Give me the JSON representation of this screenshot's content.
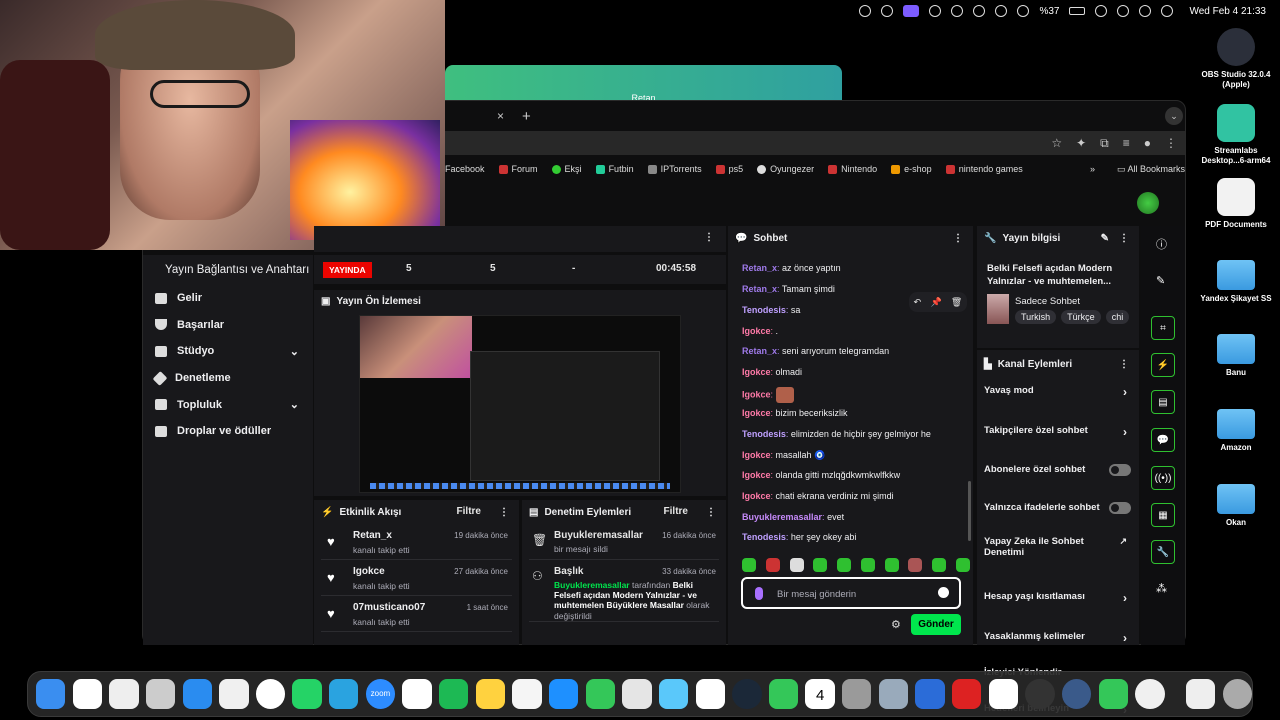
{
  "menubar": {
    "battery": "%37",
    "clock": "Wed Feb 4  21:33"
  },
  "background_window": {
    "title": "Retan"
  },
  "browser": {
    "tab_close": "×",
    "tab_new": "+",
    "bookmarks": [
      "Facebook",
      "Forum",
      "Ekşi",
      "Futbin",
      "IPTorrents",
      "ps5",
      "Oyungezer",
      "Nintendo",
      "e-shop",
      "nintendo games"
    ],
    "bookmarks_overflow": "»",
    "all_bookmarks": "All Bookmarks"
  },
  "nav": {
    "first": "Yayın Bağlantısı ve Anahtarı",
    "items": [
      {
        "label": "Gelir",
        "expand": false
      },
      {
        "label": "Başarılar",
        "expand": false
      },
      {
        "label": "Stüdyo",
        "expand": true
      },
      {
        "label": "Denetleme",
        "expand": false
      },
      {
        "label": "Topluluk",
        "expand": true
      },
      {
        "label": "Droplar ve ödüller",
        "expand": false
      }
    ]
  },
  "status": {
    "live": "YAYINDA",
    "stat1": "5",
    "stat2": "5",
    "stat3": "-",
    "uptime": "00:45:58"
  },
  "preview": {
    "title": "Yayın Ön İzlemesi"
  },
  "activity": {
    "title": "Etkinlik Akışı",
    "filter": "Filtre",
    "rows": [
      {
        "name": "Retan_x",
        "sub": "kanalı takip etti",
        "time": "19 dakika önce"
      },
      {
        "name": "Igokce",
        "sub": "kanalı takip etti",
        "time": "27 dakika önce"
      },
      {
        "name": "07musticano07",
        "sub": "kanalı takip etti",
        "time": "1 saat önce"
      }
    ]
  },
  "modactions": {
    "title": "Denetim Eylemleri",
    "filter": "Filtre",
    "row1": {
      "name": "Buyukleremasallar",
      "sub": "bir mesajı sildi",
      "time": "16 dakika önce"
    },
    "row2": {
      "name": "Başlık",
      "time": "33 dakika önce",
      "actor": "Buyukleremasallar",
      "by": "tarafından",
      "target": "Belki Felsefi açıdan Modern Yalnızlar - ve muhtemelen Büyüklere Masallar",
      "suffix": "olarak değiştirildi"
    }
  },
  "chat": {
    "title": "Sohbet",
    "lines": [
      {
        "user": "Retan_x",
        "cls": "u-retan",
        "text": "az önce yaptın"
      },
      {
        "user": "Retan_x",
        "cls": "u-retan",
        "text": "Tamam şimdi"
      },
      {
        "user": "Tenodesis",
        "cls": "u-teno",
        "text": "sa"
      },
      {
        "user": "Igokce",
        "cls": "u-igk",
        "text": "."
      },
      {
        "user": "Retan_x",
        "cls": "u-retan",
        "text": "seni arıyorum telegramdan"
      },
      {
        "user": "Igokce",
        "cls": "u-igk",
        "text": "olmadi"
      },
      {
        "user": "Igokce",
        "cls": "u-igk",
        "text": ""
      },
      {
        "user": "Igokce",
        "cls": "u-igk",
        "text": "bizim beceriksizlik"
      },
      {
        "user": "Tenodesis",
        "cls": "u-teno",
        "text": "elimizden de hiçbir şey gelmiyor he"
      },
      {
        "user": "Igokce",
        "cls": "u-igk",
        "text": "masallah 🧿"
      },
      {
        "user": "Igokce",
        "cls": "u-igk",
        "text": "olanda gitti mzlqğdkwmkwlfkkw"
      },
      {
        "user": "Igokce",
        "cls": "u-igk",
        "text": "chati ekrana verdiniz mi şimdi"
      },
      {
        "user": "Buyukleremasallar",
        "cls": "u-buy",
        "text": "evet"
      },
      {
        "user": "Tenodesis",
        "cls": "u-teno",
        "text": "her şey okey abi"
      }
    ],
    "placeholder": "Bir mesaj gönderin",
    "send": "Gönder"
  },
  "streaminfo": {
    "title": "Yayın bilgisi",
    "stream_title": "Belki Felsefi açıdan Modern Yalnızlar - ve muhtemelen...",
    "category": "Sadece Sohbet",
    "tags": [
      "Turkish",
      "Türkçe",
      "chi"
    ]
  },
  "chanactions": {
    "title": "Kanal Eylemleri",
    "rows": [
      {
        "label": "Yavaş mod",
        "kind": "arrow"
      },
      {
        "label": "Takipçilere özel sohbet",
        "kind": "arrow"
      },
      {
        "label": "Abonelere özel sohbet",
        "kind": "toggle"
      },
      {
        "label": "Yalnızca ifadelerle sohbet",
        "kind": "toggle"
      },
      {
        "label": "Yapay Zeka ile Sohbet Denetimi",
        "kind": "external"
      },
      {
        "label": "Hesap yaşı kısıtlaması",
        "kind": "arrow"
      },
      {
        "label": "Yasaklanmış kelimeler",
        "kind": "arrow"
      },
      {
        "label": "İzleyici Yönlendir",
        "kind": "none"
      },
      {
        "label": "Hedefleri belirleyin",
        "kind": "arrow"
      }
    ]
  },
  "desktop": [
    {
      "label": "OBS Studio 32.0.4 (Apple)",
      "kind": "app",
      "color": "#2b2f3a"
    },
    {
      "label": "Streamlabs Desktop...6-arm64",
      "kind": "app",
      "color": "#31c3a2"
    },
    {
      "label": "PDF Documents",
      "kind": "doc",
      "color": "#f2f2f2"
    },
    {
      "label": "Yandex Şikayet SS",
      "kind": "folder",
      "color": "#4aa8ea"
    },
    {
      "label": "Banu",
      "kind": "folder",
      "color": "#4aa8ea"
    },
    {
      "label": "Amazon",
      "kind": "folder",
      "color": "#4aa8ea"
    },
    {
      "label": "Okan",
      "kind": "folder",
      "color": "#4aa8ea"
    }
  ],
  "dock": {
    "apps": [
      "finder",
      "yandex",
      "textedit",
      "launchpad",
      "safari",
      "chrome",
      "chatgpt",
      "whatsapp",
      "telegram",
      "zoom",
      "arc",
      "spotify",
      "notes",
      "photos",
      "appstore",
      "messages",
      "pocket",
      "maps",
      "ghub",
      "steam",
      "facetime",
      "calendar",
      "settings",
      "preview",
      "vpn",
      "mcd",
      "capcut",
      "obs",
      "league",
      "phone",
      "viber",
      "docs",
      "trash"
    ],
    "calendar_day": "4",
    "zoom_label": "zoom"
  },
  "colors": {
    "accent_green": "#00e64d",
    "live_red": "#eb0400",
    "panel_bg": "#18181b",
    "retan": "#9f7aea",
    "igokce": "#ff7aa8"
  }
}
